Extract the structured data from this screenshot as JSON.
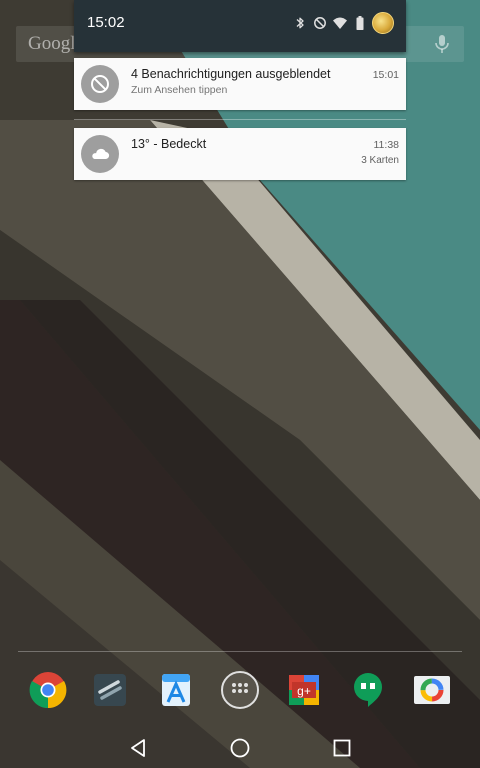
{
  "status_bar": {
    "time": "15:02",
    "icons": [
      "bluetooth-icon",
      "do-not-disturb-icon",
      "wifi-icon",
      "battery-icon",
      "avatar"
    ]
  },
  "search_bar": {
    "logo_text": "Google",
    "mic_icon": "mic-icon"
  },
  "notifications": [
    {
      "icon": "do-not-disturb-icon",
      "title": "4 Benachrichtigungen ausgeblendet",
      "subtitle": "Zum Ansehen tippen",
      "time": "15:01",
      "count": ""
    },
    {
      "icon": "cloud-icon",
      "title": "13° - Bedeckt",
      "subtitle": "",
      "time": "11:38",
      "count": "3 Karten"
    }
  ],
  "dock": {
    "apps": [
      "chrome-icon",
      "app-drawer-stack-icon",
      "apps-icon",
      "all-apps-icon",
      "google-plus-icon",
      "hangouts-icon",
      "photos-icon"
    ]
  },
  "navigation": {
    "buttons": [
      "back-icon",
      "home-icon",
      "recents-icon"
    ]
  },
  "colors": {
    "shade_background": "#263238",
    "card_background": "#fafafa",
    "notification_icon_bg": "#9e9e9e",
    "wallpaper_teal": "#4a8a84"
  }
}
